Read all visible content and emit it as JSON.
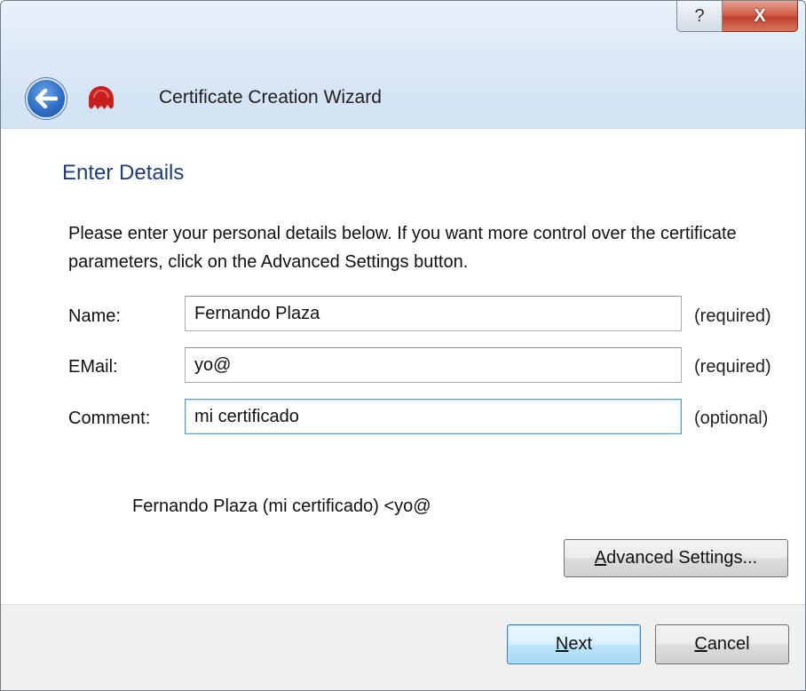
{
  "window": {
    "help_glyph": "?",
    "close_glyph": "X",
    "title": "Certificate Creation Wizard"
  },
  "page": {
    "heading": "Enter Details",
    "description": "Please enter your personal details below. If you want more control over the certificate parameters, click on the Advanced Settings button."
  },
  "form": {
    "name": {
      "label": "Name:",
      "value": "Fernando Plaza",
      "note": "(required)"
    },
    "email": {
      "label": "EMail:",
      "value": "yo@",
      "note": "(required)"
    },
    "comment": {
      "label": "Comment:",
      "value": "mi certificado",
      "note": "(optional)"
    }
  },
  "preview_text": "Fernando Plaza (mi certificado) <yo@",
  "buttons": {
    "advanced": {
      "accel": "A",
      "rest": "dvanced Settings..."
    },
    "next": {
      "accel": "N",
      "rest": "ext"
    },
    "cancel": {
      "accel": "C",
      "rest": "ancel"
    }
  },
  "colors": {
    "heading": "#1f3d7a",
    "back_button": "#2d6fc6",
    "close_button": "#c0412d",
    "app_icon": "#c8201e"
  }
}
